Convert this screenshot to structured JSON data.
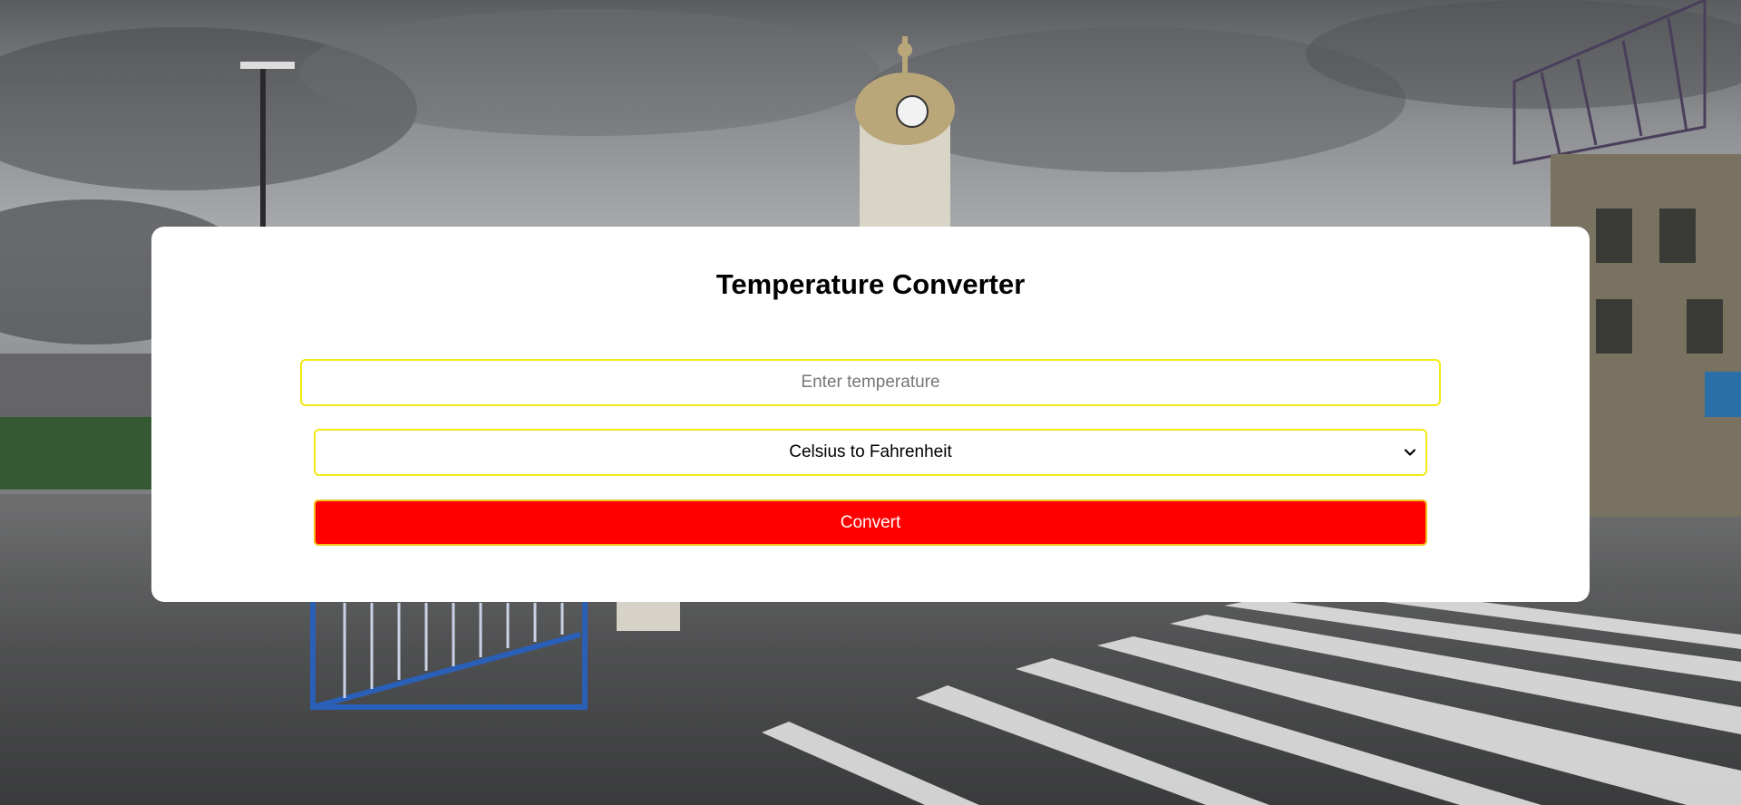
{
  "app": {
    "title": "Temperature Converter"
  },
  "form": {
    "temperature_input": {
      "value": "",
      "placeholder": "Enter temperature"
    },
    "conversion_select": {
      "selected": "Celsius to Fahrenheit"
    },
    "convert_button_label": "Convert"
  },
  "colors": {
    "card_background": "#ffffff",
    "input_border": "#f2ea16",
    "button_background": "#ff0000",
    "button_text": "#ffffff"
  },
  "icons": {
    "select_arrow": "chevron-down-icon"
  }
}
